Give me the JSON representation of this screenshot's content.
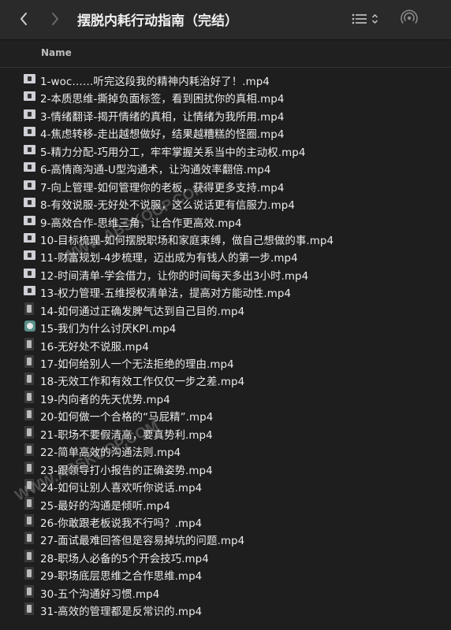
{
  "toolbar": {
    "title": "摆脱内耗行动指南（完结）"
  },
  "header": {
    "name_column": "Name"
  },
  "files": [
    {
      "name": "1-woc……听完这段我的精神内耗治好了！.mp4",
      "thumb": "wide"
    },
    {
      "name": "2-本质思维-撕掉负面标签，看到困扰你的真相.mp4",
      "thumb": "wide"
    },
    {
      "name": "3-情绪翻译-揭开情绪的真相，让情绪为我所用.mp4",
      "thumb": "wide"
    },
    {
      "name": "4-焦虑转移-走出越想做好，结果越糟糕的怪圈.mp4",
      "thumb": "wide"
    },
    {
      "name": "5-精力分配-巧用分工，牢牢掌握关系当中的主动权.mp4",
      "thumb": "wide"
    },
    {
      "name": "6-高情商沟通-U型沟通术，让沟通效率翻倍.mp4",
      "thumb": "wide"
    },
    {
      "name": "7-向上管理-如何管理你的老板，获得更多支持.mp4",
      "thumb": "wide"
    },
    {
      "name": "8-有效说服-无好处不说服，这么说话更有信服力.mp4",
      "thumb": "wide"
    },
    {
      "name": "9-高效合作-思维三角，让合作更高效.mp4",
      "thumb": "wide"
    },
    {
      "name": "10-目标梳理-如何摆脱职场和家庭束缚，做自己想做的事.mp4",
      "thumb": "wide"
    },
    {
      "name": "11-财富规划-4步梳理，迈出成为有钱人的第一步.mp4",
      "thumb": "wide"
    },
    {
      "name": "12-时间清单-学会借力，让你的时间每天多出3小时.mp4",
      "thumb": "wide"
    },
    {
      "name": "13-权力管理-五维授权清单法，提高对方能动性.mp4",
      "thumb": "wide"
    },
    {
      "name": "14-如何通过正确发脾气达到自己目的.mp4",
      "thumb": "tall"
    },
    {
      "name": "15-我们为什么讨厌KPI.mp4",
      "thumb": "icon"
    },
    {
      "name": "16-无好处不说服.mp4",
      "thumb": "tall"
    },
    {
      "name": "17-如何给别人一个无法拒绝的理由.mp4",
      "thumb": "tall"
    },
    {
      "name": "18-无效工作和有效工作仅仅一步之差.mp4",
      "thumb": "tall"
    },
    {
      "name": "19-内向者的先天优势.mp4",
      "thumb": "tall"
    },
    {
      "name": "20-如何做一个合格的“马屁精”.mp4",
      "thumb": "tall"
    },
    {
      "name": "21-职场不要假清高，要真势利.mp4",
      "thumb": "tall"
    },
    {
      "name": "22-简单高效的沟通法则.mp4",
      "thumb": "tall"
    },
    {
      "name": "23-跟领导打小报告的正确姿势.mp4",
      "thumb": "tall"
    },
    {
      "name": "24-如何让别人喜欢听你说话.mp4",
      "thumb": "tall"
    },
    {
      "name": "25-最好的沟通是倾听.mp4",
      "thumb": "tall"
    },
    {
      "name": "26-你敢跟老板说我不行吗？.mp4",
      "thumb": "tall"
    },
    {
      "name": "27-面试最难回答但是容易掉坑的问题.mp4",
      "thumb": "tall"
    },
    {
      "name": "28-职场人必备的5个开会技巧.mp4",
      "thumb": "tall"
    },
    {
      "name": "29-职场底层思维之合作思维.mp4",
      "thumb": "tall"
    },
    {
      "name": "30-五个沟通好习惯.mp4",
      "thumb": "tall"
    },
    {
      "name": "31-高效的管理都是反常识的.mp4",
      "thumb": "tall"
    }
  ],
  "watermark": {
    "text_a": "WWW.ABSKOOP.COM",
    "text_b": "WWW.ABSKOOP.COM"
  }
}
